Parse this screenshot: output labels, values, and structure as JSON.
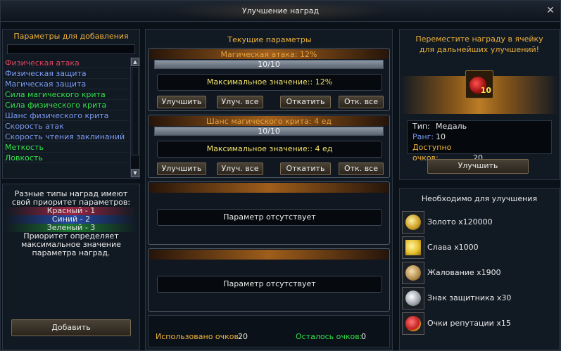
{
  "window": {
    "title": "Улучшение наград"
  },
  "left_panel": {
    "header": "Параметры для добавления",
    "items": [
      {
        "label": "Физическая атака",
        "color": "#e0465e"
      },
      {
        "label": "Физическая защита",
        "color": "#7a9bf0"
      },
      {
        "label": "Магическая защита",
        "color": "#7a9bf0"
      },
      {
        "label": "Сила магического крита",
        "color": "#33e04a"
      },
      {
        "label": "Сила физического крита",
        "color": "#33e04a"
      },
      {
        "label": "Шанс физического крита",
        "color": "#7a9bf0"
      },
      {
        "label": "Скорость атак",
        "color": "#7a9bf0"
      },
      {
        "label": "Скорость чтения заклинаний",
        "color": "#7a9bf0"
      },
      {
        "label": "Меткость",
        "color": "#33e04a"
      },
      {
        "label": "Ловкость",
        "color": "#33e04a"
      }
    ]
  },
  "priority": {
    "line1": "Разные типы наград имеют",
    "line2": "свой приоритет параметров:",
    "red": "Красный - 1",
    "blue": "Синий - 2",
    "green": "Зеленый - 3",
    "note1": "Приоритет определяет",
    "note2": "максимальное значение",
    "note3": "параметра наград.",
    "add_button": "Добавить"
  },
  "middle": {
    "header": "Текущие параметры",
    "cards": [
      {
        "title": "Магическая атака: 12%",
        "progress_text": "10/10",
        "progress": 1.0,
        "max": "Максимальное значение:: 12%",
        "buttons": [
          "Улучшить",
          "Улуч. все",
          "Откатить",
          "Отк. все"
        ]
      },
      {
        "title": "Шанс магического крита: 4 ед",
        "progress_text": "10/10",
        "progress": 1.0,
        "max": "Максимальное значение:: 4 ед",
        "buttons": [
          "Улучшить",
          "Улуч. все",
          "Откатить",
          "Отк. все"
        ]
      }
    ],
    "empty1": "Параметр отсутствует",
    "empty2": "Параметр отсутствует",
    "used_label": "Использовано очков:",
    "used_value": "20",
    "left_label": "Осталось очков:",
    "left_value": "0",
    "used_color": "#f0b33a",
    "left_color": "#33e04a"
  },
  "reward": {
    "header1": "Переместите награду в ячейку",
    "header2": "для дальнейших улучшений!",
    "slot_count": "10",
    "type_label": "Тип:",
    "type_value": "Медаль",
    "rank_label": "Ранг:",
    "rank_value": "10",
    "points_label": "Доступно очков:",
    "points_value": "20",
    "improve_button": "Улучшить"
  },
  "requirements": {
    "header": "Необходимо для улучшения",
    "items": [
      {
        "label": "Золото x120000",
        "icon": "gold-icon"
      },
      {
        "label": "Слава x1000",
        "icon": "glory-icon"
      },
      {
        "label": "Жалование x1900",
        "icon": "salary-icon"
      },
      {
        "label": "Знак защитника x30",
        "icon": "defender-badge-icon"
      },
      {
        "label": "Очки репутации x15",
        "icon": "reputation-icon"
      }
    ]
  }
}
